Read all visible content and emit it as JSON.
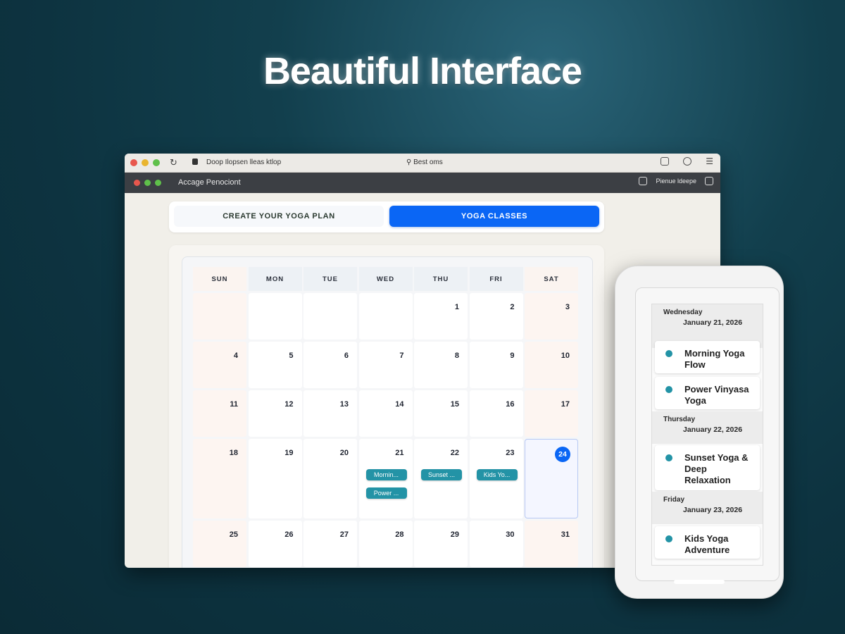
{
  "headline": "Beautiful Interface",
  "browser": {
    "url_text": "Doop Ilopsen lleas ktlop",
    "search_text": "Best oms",
    "app_title": "Accage Penociont",
    "app_right_label": "Pienue ldeepe"
  },
  "tabs": {
    "plan_label": "CREATE YOUR YOGA PLAN",
    "classes_label": "YOGA CLASSES"
  },
  "calendar": {
    "weekdays": [
      "SUN",
      "MON",
      "TUE",
      "WED",
      "THU",
      "FRI",
      "SAT"
    ],
    "weeks": [
      [
        "",
        "",
        "",
        "",
        "1",
        "2",
        "3"
      ],
      [
        "4",
        "5",
        "6",
        "7",
        "8",
        "9",
        "10"
      ],
      [
        "11",
        "12",
        "13",
        "14",
        "15",
        "16",
        "17"
      ],
      [
        "18",
        "19",
        "20",
        "21",
        "22",
        "23",
        "24"
      ],
      [
        "25",
        "26",
        "27",
        "28",
        "29",
        "30",
        "31"
      ]
    ],
    "today": "24",
    "events": {
      "21": [
        "Mornin...",
        "Power ..."
      ],
      "22": [
        "Sunset ..."
      ],
      "23": [
        "Kids Yo..."
      ]
    },
    "colors": {
      "accent": "#0a66f5",
      "event": "#2393a6"
    }
  },
  "phone": {
    "days": [
      {
        "day": "Wednesday",
        "date": "January 21, 2026",
        "classes": [
          "Morning Yoga Flow",
          "Power Vinyasa Yoga"
        ]
      },
      {
        "day": "Thursday",
        "date": "January 22, 2026",
        "classes": [
          "Sunset Yoga & Deep Relaxation"
        ]
      },
      {
        "day": "Friday",
        "date": "January 23, 2026",
        "classes": [
          "Kids Yoga Adventure"
        ]
      }
    ]
  }
}
